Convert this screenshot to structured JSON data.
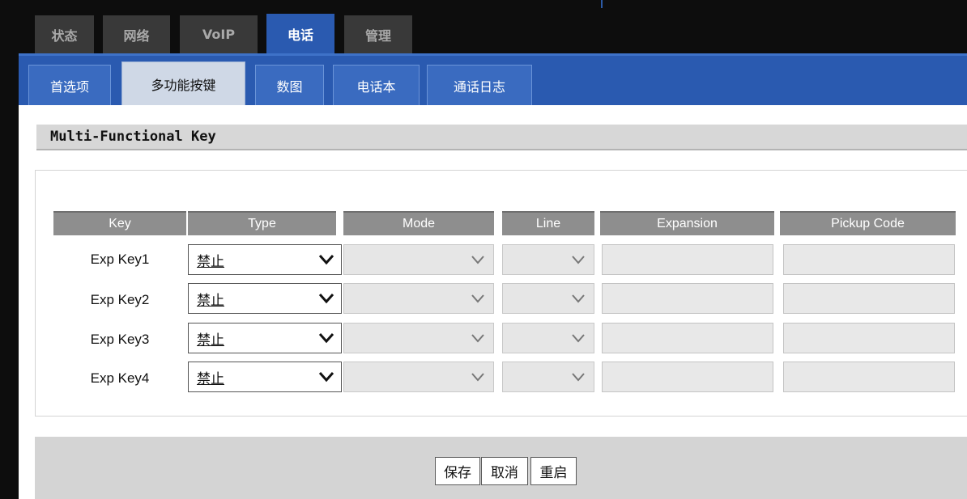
{
  "main_tabs": [
    {
      "label": "状态"
    },
    {
      "label": "网络"
    },
    {
      "label": "VoIP"
    },
    {
      "label": "电话",
      "active": true
    },
    {
      "label": "管理"
    }
  ],
  "sub_tabs": [
    {
      "label": "首选项"
    },
    {
      "label": "多功能按键",
      "active": true
    },
    {
      "label": "数图"
    },
    {
      "label": "电话本"
    },
    {
      "label": "通话日志"
    }
  ],
  "section": {
    "title": "Multi-Functional Key"
  },
  "table": {
    "headers": [
      "Key",
      "Type",
      "Mode",
      "Line",
      "Expansion",
      "Pickup Code"
    ],
    "rows": [
      {
        "key": "Exp Key1",
        "type": "禁止",
        "mode": "",
        "line": "",
        "expansion": "",
        "pickup_code": ""
      },
      {
        "key": "Exp Key2",
        "type": "禁止",
        "mode": "",
        "line": "",
        "expansion": "",
        "pickup_code": ""
      },
      {
        "key": "Exp Key3",
        "type": "禁止",
        "mode": "",
        "line": "",
        "expansion": "",
        "pickup_code": ""
      },
      {
        "key": "Exp Key4",
        "type": "禁止",
        "mode": "",
        "line": "",
        "expansion": "",
        "pickup_code": ""
      }
    ]
  },
  "buttons": {
    "save": "保存",
    "cancel": "取消",
    "reboot": "重启"
  },
  "colors": {
    "accent": "#2a5ab0",
    "header_gray": "#8e8e8e",
    "top_bar": "#0d0d0d"
  }
}
